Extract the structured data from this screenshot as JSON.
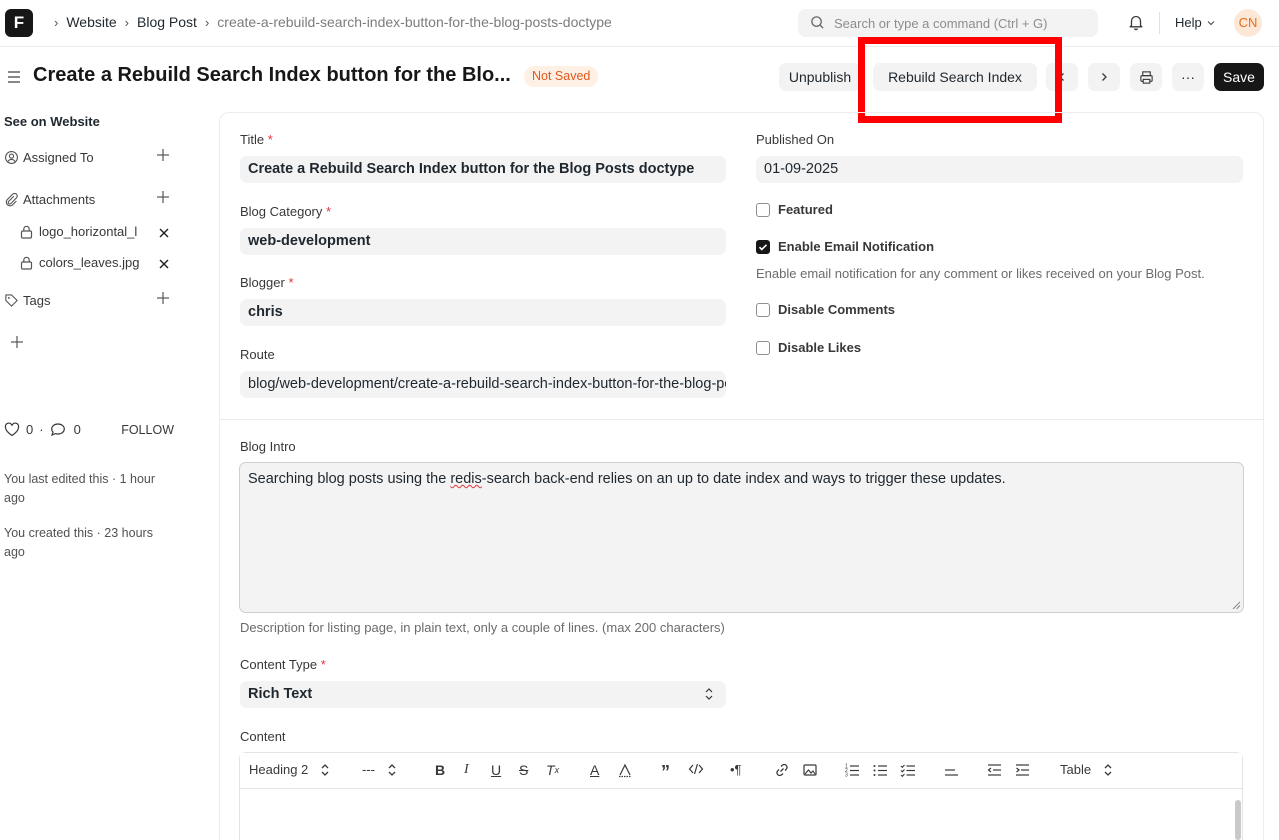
{
  "navbar": {
    "logo_letter": "F",
    "breadcrumbs": [
      "Website",
      "Blog Post",
      "create-a-rebuild-search-index-button-for-the-blog-posts-doctype"
    ],
    "search_placeholder": "Search or type a command (Ctrl + G)",
    "help_label": "Help",
    "avatar_initials": "CN"
  },
  "page": {
    "title": "Create a Rebuild Search Index button for the Blo...",
    "status": "Not Saved",
    "buttons": {
      "unpublish": "Unpublish",
      "rebuild": "Rebuild Search Index",
      "save": "Save",
      "more": "···"
    }
  },
  "sidebar": {
    "see_on_website": "See on Website",
    "assigned_to": "Assigned To",
    "attachments": "Attachments",
    "attachment_files": [
      "logo_horizontal_l",
      "colors_leaves.jpg"
    ],
    "tags": "Tags",
    "likes_count": "0",
    "comments_count": "0",
    "follow": "FOLLOW",
    "activity": [
      "You last edited this · 1 hour ago",
      "You created this · 23 hours ago"
    ]
  },
  "form": {
    "title_label": "Title",
    "title_value": "Create a Rebuild Search Index button for the Blog Posts doctype",
    "category_label": "Blog Category",
    "category_value": "web-development",
    "blogger_label": "Blogger",
    "blogger_value": "chris",
    "route_label": "Route",
    "route_value": "blog/web-development/create-a-rebuild-search-index-button-for-the-blog-posts-doctype",
    "published_on_label": "Published On",
    "published_on_value": "01-09-2025",
    "featured_label": "Featured",
    "email_notification_label": "Enable Email Notification",
    "email_notification_help": "Enable email notification for any comment or likes received on your Blog Post.",
    "disable_comments_label": "Disable Comments",
    "disable_likes_label": "Disable Likes",
    "intro_label": "Blog Intro",
    "intro_value_before": "Searching blog posts using the ",
    "intro_value_misspelled": "redis",
    "intro_value_after": "-search back-end relies on an up to date index and ways to trigger these updates.",
    "intro_help": "Description for listing page, in plain text, only a couple of lines. (max 200 characters)",
    "content_type_label": "Content Type",
    "content_type_value": "Rich Text",
    "content_label": "Content",
    "required_mark": "*"
  },
  "editor": {
    "heading_select": "Heading 2",
    "size_select": "---",
    "table_label": "Table"
  },
  "colors": {
    "accent_dark": "#171717",
    "status_orange": "#e2581c",
    "highlight_red": "#ff0000"
  }
}
